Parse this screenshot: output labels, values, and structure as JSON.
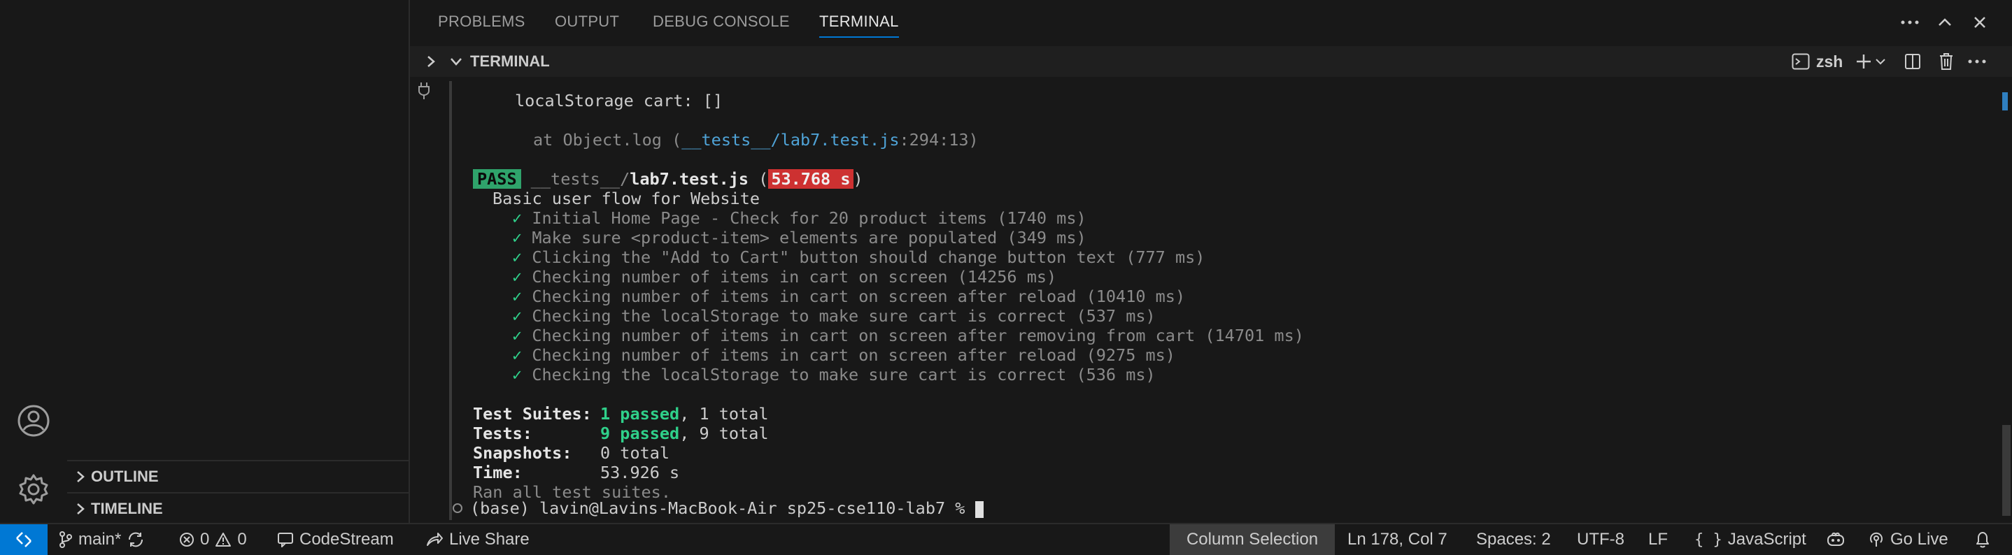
{
  "panel": {
    "tabs": [
      {
        "label": "PROBLEMS"
      },
      {
        "label": "OUTPUT"
      },
      {
        "label": "DEBUG CONSOLE"
      },
      {
        "label": "TERMINAL"
      }
    ],
    "active_tab": "TERMINAL"
  },
  "terminal": {
    "header_title": "TERMINAL",
    "shell_name": "zsh",
    "lines": {
      "l1": "localStorage cart: []",
      "l2_prefix": "at Object.log (",
      "l2_link": "__tests__/lab7.test.js",
      "l2_suffix": ":294:13)",
      "pass_badge": "PASS",
      "test_dir": "__tests__/",
      "test_file": "lab7.test.js",
      "test_time": "53.768 s",
      "suite_name": "Basic user flow for Website",
      "tests": [
        "Initial Home Page - Check for 20 product items (1740 ms)",
        "Make sure <product-item> elements are populated (349 ms)",
        "Clicking the \"Add to Cart\" button should change button text (777 ms)",
        "Checking number of items in cart on screen (14256 ms)",
        "Checking number of items in cart on screen after reload (10410 ms)",
        "Checking the localStorage to make sure cart is correct (537 ms)",
        "Checking number of items in cart on screen after removing from cart (14701 ms)",
        "Checking number of items in cart on screen after reload (9275 ms)",
        "Checking the localStorage to make sure cart is correct (536 ms)"
      ],
      "check_mark": "✓",
      "summary": {
        "suites_label": "Test Suites:",
        "suites_passed": "1 passed",
        "suites_total": ", 1 total",
        "tests_label": "Tests:",
        "tests_passed": "9 passed",
        "tests_total": ", 9 total",
        "snapshots_label": "Snapshots:",
        "snapshots_value": "0 total",
        "time_label": "Time:",
        "time_value": "53.926 s"
      },
      "ran_all": "Ran all test suites.",
      "prompt": "(base) lavin@Lavins-MacBook-Air sp25-cse110-lab7 % "
    }
  },
  "sidebar": {
    "sections": [
      {
        "label": "OUTLINE"
      },
      {
        "label": "TIMELINE"
      }
    ]
  },
  "status_bar": {
    "branch": "main*",
    "errors": "0",
    "warnings": "0",
    "codestream": "CodeStream",
    "live_share": "Live Share",
    "column_selection": "Column Selection",
    "cursor_position": "Ln 178, Col 7",
    "spaces": "Spaces: 2",
    "encoding": "UTF-8",
    "eol": "LF",
    "language_braces": "{ }",
    "language": "JavaScript",
    "go_live": "Go Live"
  },
  "colors": {
    "accent": "#0078d4",
    "pass_green": "#2fa36b",
    "fail_red": "#cd3131",
    "link_blue": "#4fa3d7"
  }
}
